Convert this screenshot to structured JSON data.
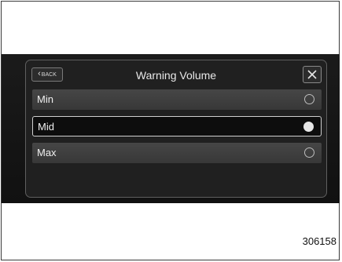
{
  "header": {
    "back_label": "BACK",
    "title": "Warning Volume"
  },
  "options": [
    {
      "label": "Min",
      "selected": false
    },
    {
      "label": "Mid",
      "selected": true
    },
    {
      "label": "Max",
      "selected": false
    }
  ],
  "figure_number": "306158",
  "colors": {
    "screen_bg": "#1b1b1b",
    "row_bg": "#404040",
    "selected_row_bg": "#0d0d0d",
    "text": "#efefef"
  }
}
